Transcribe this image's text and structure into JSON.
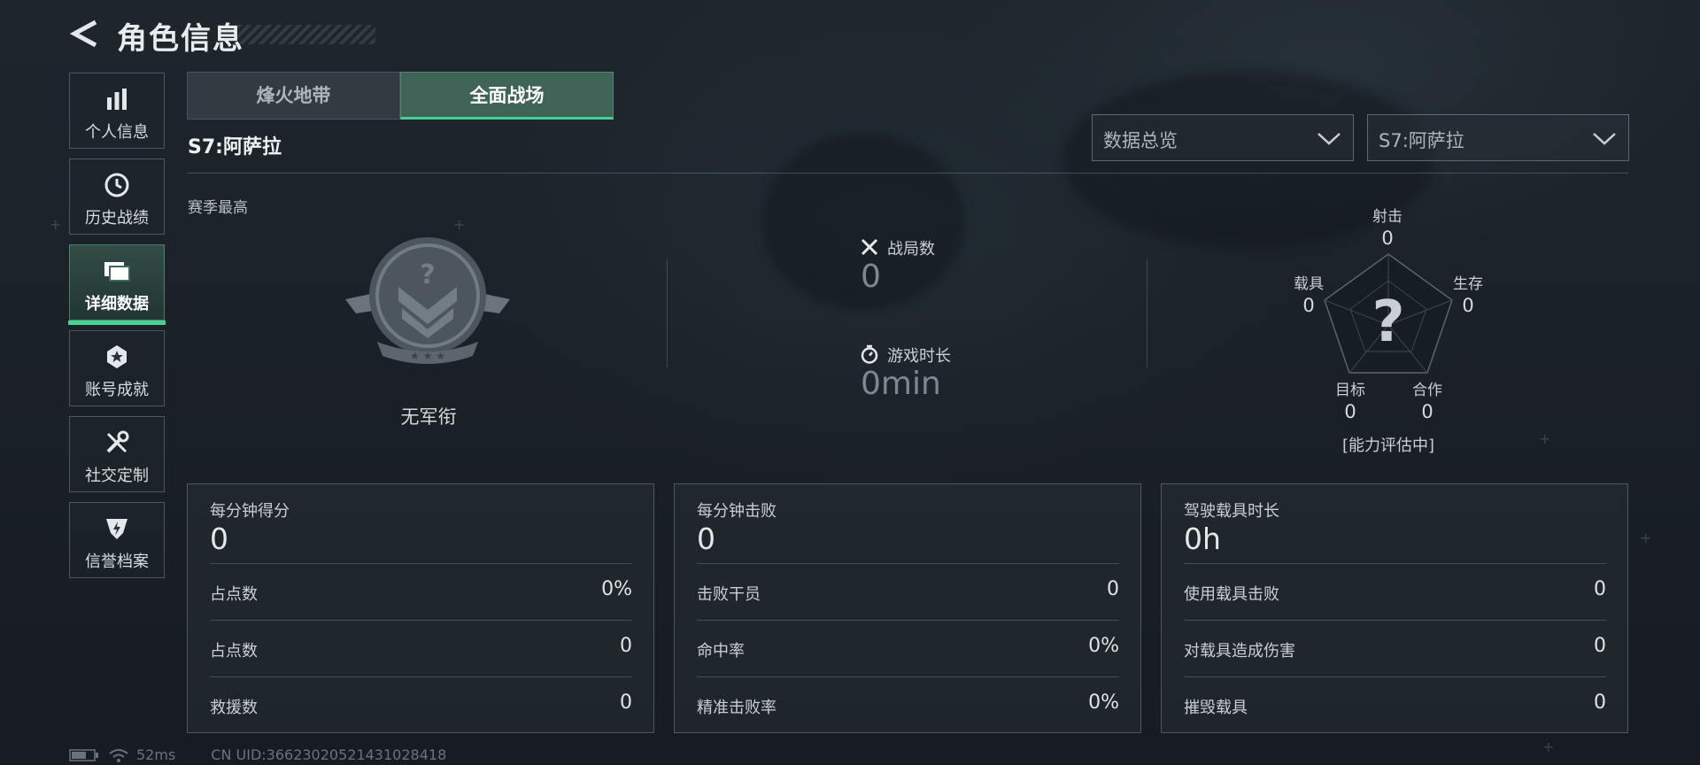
{
  "header": {
    "title": "角色信息"
  },
  "sidebar": {
    "items": [
      {
        "label": "个人信息",
        "icon": "bar-chart-icon"
      },
      {
        "label": "历史战绩",
        "icon": "history-clock-icon"
      },
      {
        "label": "详细数据",
        "icon": "folder-icon",
        "active": true
      },
      {
        "label": "账号成就",
        "icon": "achievement-medal-icon"
      },
      {
        "label": "社交定制",
        "icon": "wrench-tools-icon"
      },
      {
        "label": "信誉档案",
        "icon": "shield-bolt-icon"
      }
    ]
  },
  "tabs": [
    {
      "label": "烽火地带",
      "active": false
    },
    {
      "label": "全面战场",
      "active": true
    }
  ],
  "season": {
    "label": "S7:阿萨拉"
  },
  "filters": {
    "view": "数据总览",
    "season": "S7:阿萨拉"
  },
  "season_best": {
    "label": "赛季最高",
    "rank_name": "无军衔"
  },
  "stats": {
    "matches": {
      "label": "战局数",
      "value": "0"
    },
    "playtime": {
      "label": "游戏时长",
      "value": "0min"
    }
  },
  "radar": {
    "axes": [
      {
        "label": "射击",
        "value": "0"
      },
      {
        "label": "生存",
        "value": "0"
      },
      {
        "label": "合作",
        "value": "0"
      },
      {
        "label": "目标",
        "value": "0"
      },
      {
        "label": "载具",
        "value": "0"
      }
    ],
    "status": "[能力评估中]"
  },
  "panels": [
    {
      "title": "每分钟得分",
      "value": "0",
      "rows": [
        {
          "label": "占点数",
          "value": "0%"
        },
        {
          "label": "占点数",
          "value": "0"
        },
        {
          "label": "救援数",
          "value": "0"
        }
      ]
    },
    {
      "title": "每分钟击败",
      "value": "0",
      "rows": [
        {
          "label": "击败干员",
          "value": "0"
        },
        {
          "label": "命中率",
          "value": "0%"
        },
        {
          "label": "精准击败率",
          "value": "0%"
        }
      ]
    },
    {
      "title": "驾驶载具时长",
      "value": "0h",
      "rows": [
        {
          "label": "使用载具击败",
          "value": "0"
        },
        {
          "label": "对载具造成伤害",
          "value": "0"
        },
        {
          "label": "摧毁载具",
          "value": "0"
        }
      ]
    }
  ],
  "footer": {
    "ping": "52ms",
    "uid": "CN UID:36623020521431028418"
  },
  "colors": {
    "accent": "#48d093",
    "background": "#1a2127"
  }
}
